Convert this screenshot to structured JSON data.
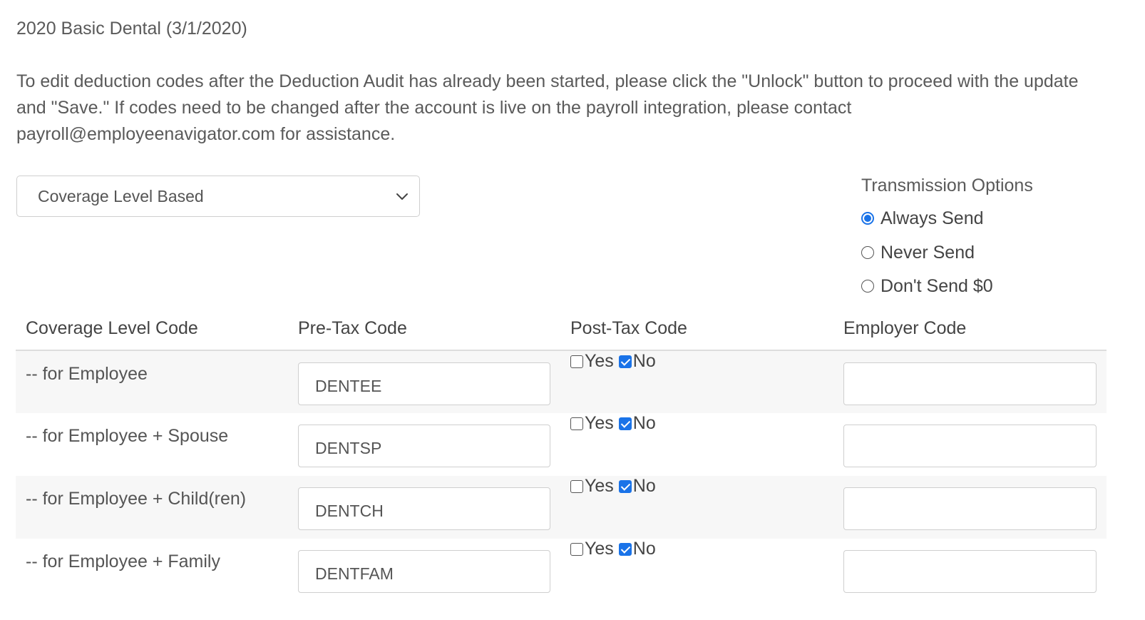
{
  "plan": {
    "title": "2020 Basic Dental (3/1/2020)"
  },
  "instructions": "To edit deduction codes after the Deduction Audit has already been started, please click the \"Unlock\" button to proceed with the update and \"Save.\" If codes need to be changed after the account is live on the payroll integration, please contact payroll@employeenavigator.com for assistance.",
  "coverage_select": {
    "value": "Coverage Level Based"
  },
  "transmission": {
    "heading": "Transmission Options",
    "options": [
      {
        "label": "Always Send",
        "selected": true
      },
      {
        "label": "Never Send",
        "selected": false
      },
      {
        "label": "Don't Send $0",
        "selected": false
      }
    ]
  },
  "table": {
    "headers": {
      "coverage": "Coverage Level Code",
      "pretax": "Pre-Tax Code",
      "posttax": "Post-Tax Code",
      "employer": "Employer Code"
    },
    "yes_label": "Yes",
    "no_label": "No",
    "rows": [
      {
        "label": "-- for Employee",
        "pretax": "DENTEE",
        "posttax_yes": false,
        "posttax_no": true,
        "employer": ""
      },
      {
        "label": "-- for Employee + Spouse",
        "pretax": "DENTSP",
        "posttax_yes": false,
        "posttax_no": true,
        "employer": ""
      },
      {
        "label": "-- for Employee + Child(ren)",
        "pretax": "DENTCH",
        "posttax_yes": false,
        "posttax_no": true,
        "employer": ""
      },
      {
        "label": "-- for Employee + Family",
        "pretax": "DENTFAM",
        "posttax_yes": false,
        "posttax_no": true,
        "employer": ""
      }
    ]
  },
  "colors": {
    "accent": "#1a73e8",
    "row_stripe": "#f7f7f7",
    "border": "#cfcfcf"
  }
}
